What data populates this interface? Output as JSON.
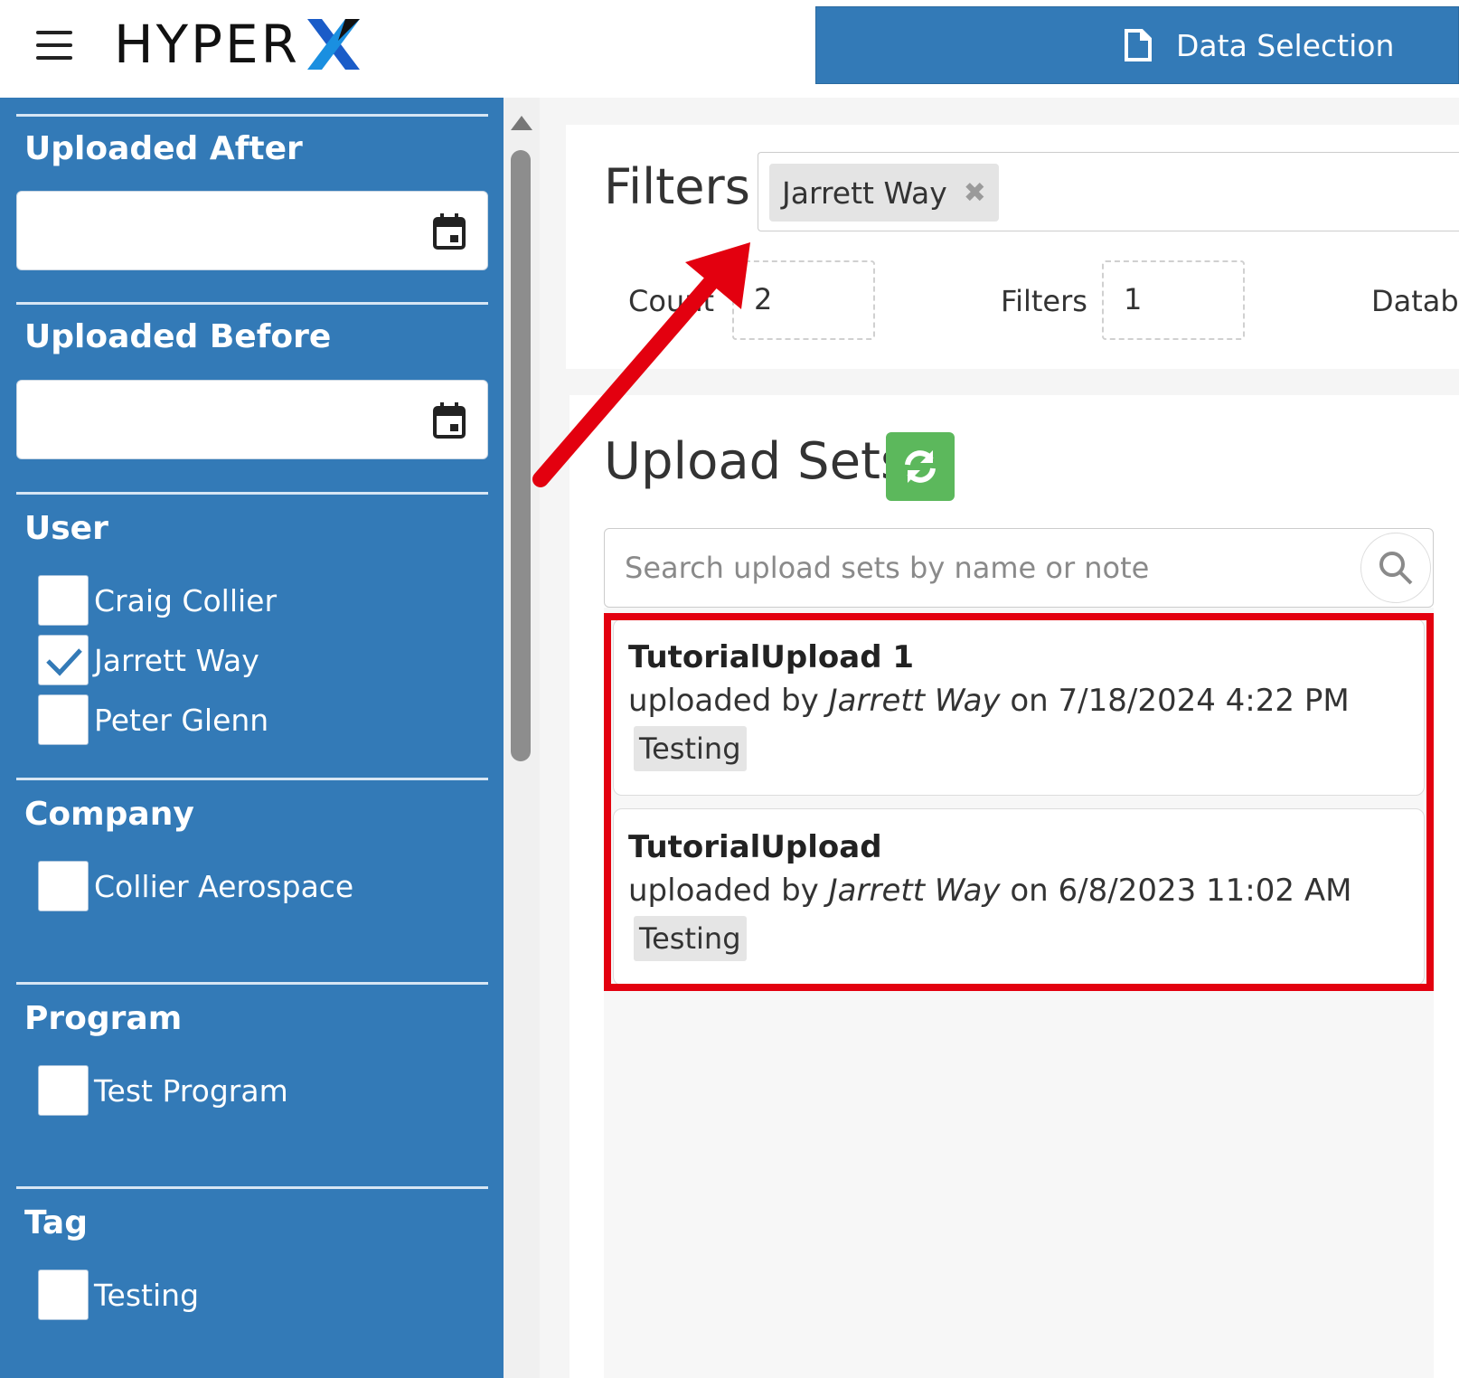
{
  "header": {
    "logo_text": "HYPER",
    "logo_mark": "X",
    "top_button_label": "Data Selection",
    "top_button_icon": "document-icon",
    "brand_color": "#337ab7"
  },
  "sidebar": {
    "uploaded_after": {
      "title": "Uploaded After",
      "value": ""
    },
    "uploaded_before": {
      "title": "Uploaded Before",
      "value": ""
    },
    "user": {
      "title": "User",
      "options": [
        {
          "label": "Craig Collier",
          "checked": false
        },
        {
          "label": "Jarrett Way",
          "checked": true
        },
        {
          "label": "Peter Glenn",
          "checked": false
        }
      ]
    },
    "company": {
      "title": "Company",
      "options": [
        {
          "label": "Collier Aerospace",
          "checked": false
        }
      ]
    },
    "program": {
      "title": "Program",
      "options": [
        {
          "label": "Test Program",
          "checked": false
        }
      ]
    },
    "tag": {
      "title": "Tag",
      "options": [
        {
          "label": "Testing",
          "checked": false
        }
      ]
    }
  },
  "filters": {
    "title": "Filters",
    "active": [
      {
        "label": "Jarrett Way"
      }
    ],
    "stats": {
      "count_label": "Count",
      "count_value": "2",
      "filters_label": "Filters",
      "filters_value": "1",
      "database_label": "Databa"
    }
  },
  "upload_sets": {
    "title": "Upload Sets",
    "search_placeholder": "Search upload sets by name or note",
    "items": [
      {
        "name": "TutorialUpload 1",
        "prefix": "uploaded by ",
        "user": "Jarrett Way",
        "mid": " on ",
        "date": "7/18/2024 4:22 PM",
        "tag": "Testing"
      },
      {
        "name": "TutorialUpload",
        "prefix": "uploaded by ",
        "user": "Jarrett Way",
        "mid": " on ",
        "date": "6/8/2023 11:02 AM",
        "tag": "Testing"
      }
    ]
  },
  "annotation_colors": {
    "arrow": "#e3000f",
    "highlight": "#e3000f",
    "refresh": "#5cb85c"
  }
}
